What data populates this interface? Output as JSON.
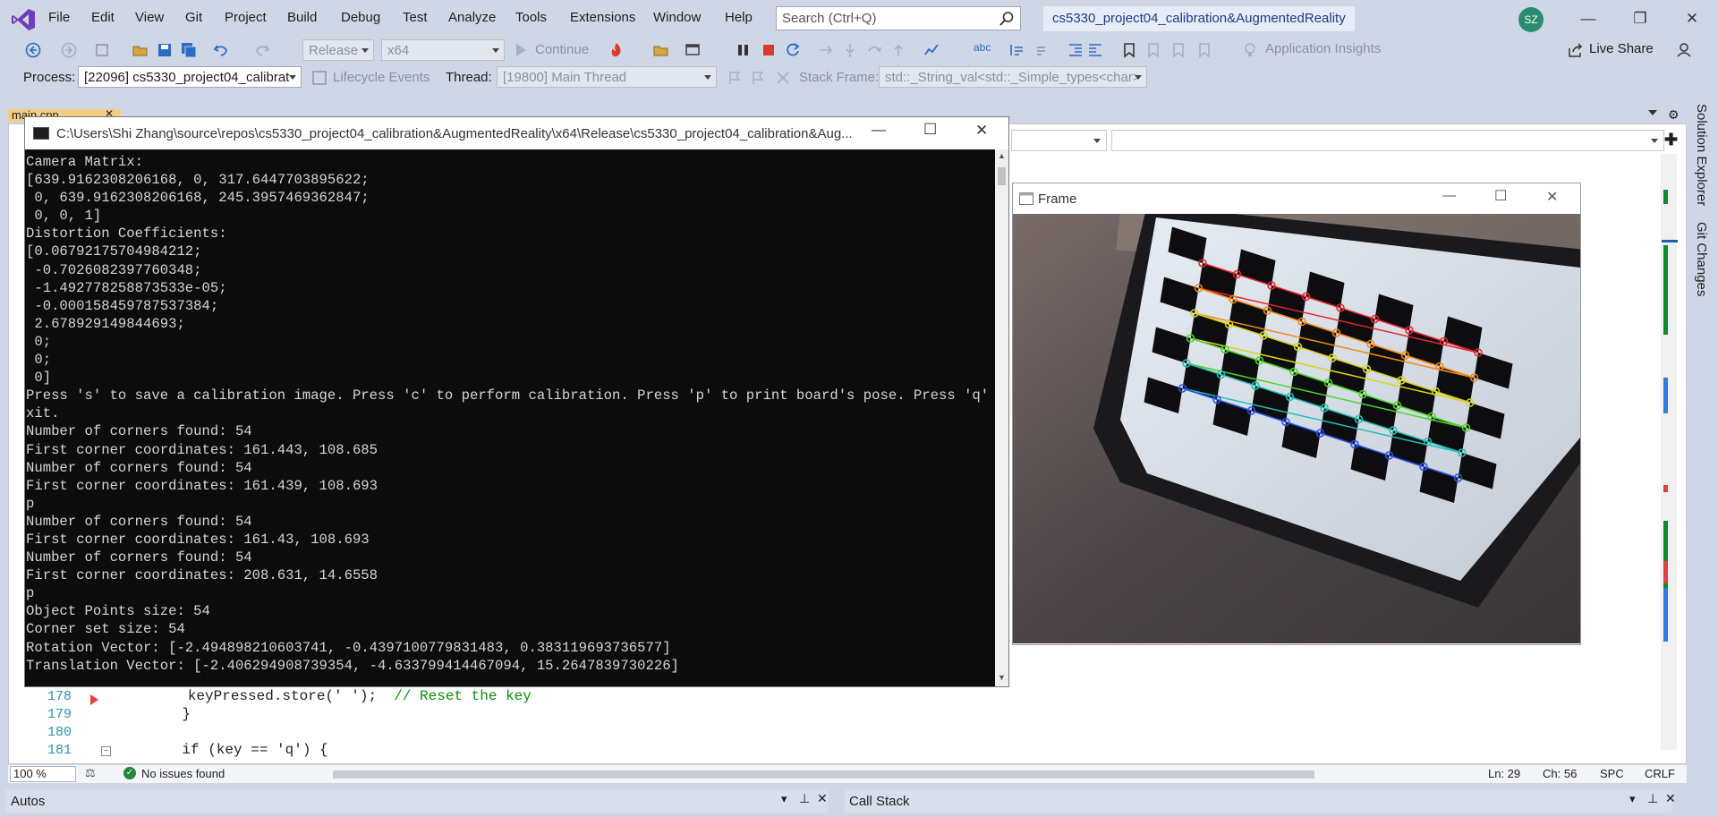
{
  "menu": {
    "items": [
      "File",
      "Edit",
      "View",
      "Git",
      "Project",
      "Build",
      "Debug",
      "Test",
      "Analyze",
      "Tools",
      "Extensions",
      "Window",
      "Help"
    ],
    "search_placeholder": "Search (Ctrl+Q)",
    "solution_name": "cs5330_project04_calibration&AugmentedReality",
    "avatar_initials": "SZ"
  },
  "toolbar": {
    "config": "Release",
    "platform": "x64",
    "continue_label": "Continue",
    "app_insights": "Application Insights",
    "live_share": "Live Share"
  },
  "debug_toolbar": {
    "process_label": "Process:",
    "process_value": "[22096] cs5330_project04_calibrat",
    "lifecycle": "Lifecycle Events",
    "thread_label": "Thread:",
    "thread_value": "[19800] Main Thread",
    "stack_frame_label": "Stack Frame:",
    "stack_frame_value": "std::_String_val<std::_Simple_types<char>"
  },
  "editor": {
    "tab": "main.cpp",
    "lines": [
      {
        "num": "178",
        "code_pre": "        keyPressed.store(' ');  ",
        "comment": "// Reset the key"
      },
      {
        "num": "179",
        "code_pre": "    }",
        "comment": ""
      },
      {
        "num": "180",
        "code_pre": "",
        "comment": ""
      },
      {
        "num": "181",
        "code_pre": "    if (key == 'q') {",
        "comment": ""
      }
    ],
    "zoom": "100 %",
    "issues": "No issues found",
    "ln": "Ln: 29",
    "ch": "Ch: 56",
    "spc": "SPC",
    "crlf": "CRLF"
  },
  "side_tabs": [
    "Solution Explorer",
    "Git Changes"
  ],
  "bottom_panels": [
    "Autos",
    "Call Stack"
  ],
  "console": {
    "title": "C:\\Users\\Shi Zhang\\source\\repos\\cs5330_project04_calibration&AugmentedReality\\x64\\Release\\cs5330_project04_calibration&Aug...",
    "lines": [
      "Camera Matrix:",
      "[639.9162308206168, 0, 317.6447703895622;",
      " 0, 639.9162308206168, 245.3957469362847;",
      " 0, 0, 1]",
      "Distortion Coefficients:",
      "[0.06792175704984212;",
      " -0.7026082397760348;",
      " -1.492778258873533e-05;",
      " -0.000158459787537384;",
      " 2.678929149844693;",
      " 0;",
      " 0;",
      " 0]",
      "Press 's' to save a calibration image. Press 'c' to perform calibration. Press 'p' to print board's pose. Press 'q' to e",
      "xit.",
      "Number of corners found: 54",
      "First corner coordinates: 161.443, 108.685",
      "Number of corners found: 54",
      "First corner coordinates: 161.439, 108.693",
      "p",
      "Number of corners found: 54",
      "First corner coordinates: 161.43, 108.693",
      "Number of corners found: 54",
      "First corner coordinates: 208.631, 14.6558",
      "p",
      "Object Points size: 54",
      "Corner set size: 54",
      "Rotation Vector: [-2.494898210603741, -0.4397100779831483, 0.383119693736577]",
      "Translation Vector: [-2.406294908739354, -4.633799414467094, 15.2647839730226]"
    ]
  },
  "frame_window": {
    "title": "Frame",
    "row_colors": [
      "#e8242a",
      "#f08a16",
      "#d8d41a",
      "#4fd32a",
      "#1fc0b6",
      "#2a52e8"
    ]
  }
}
